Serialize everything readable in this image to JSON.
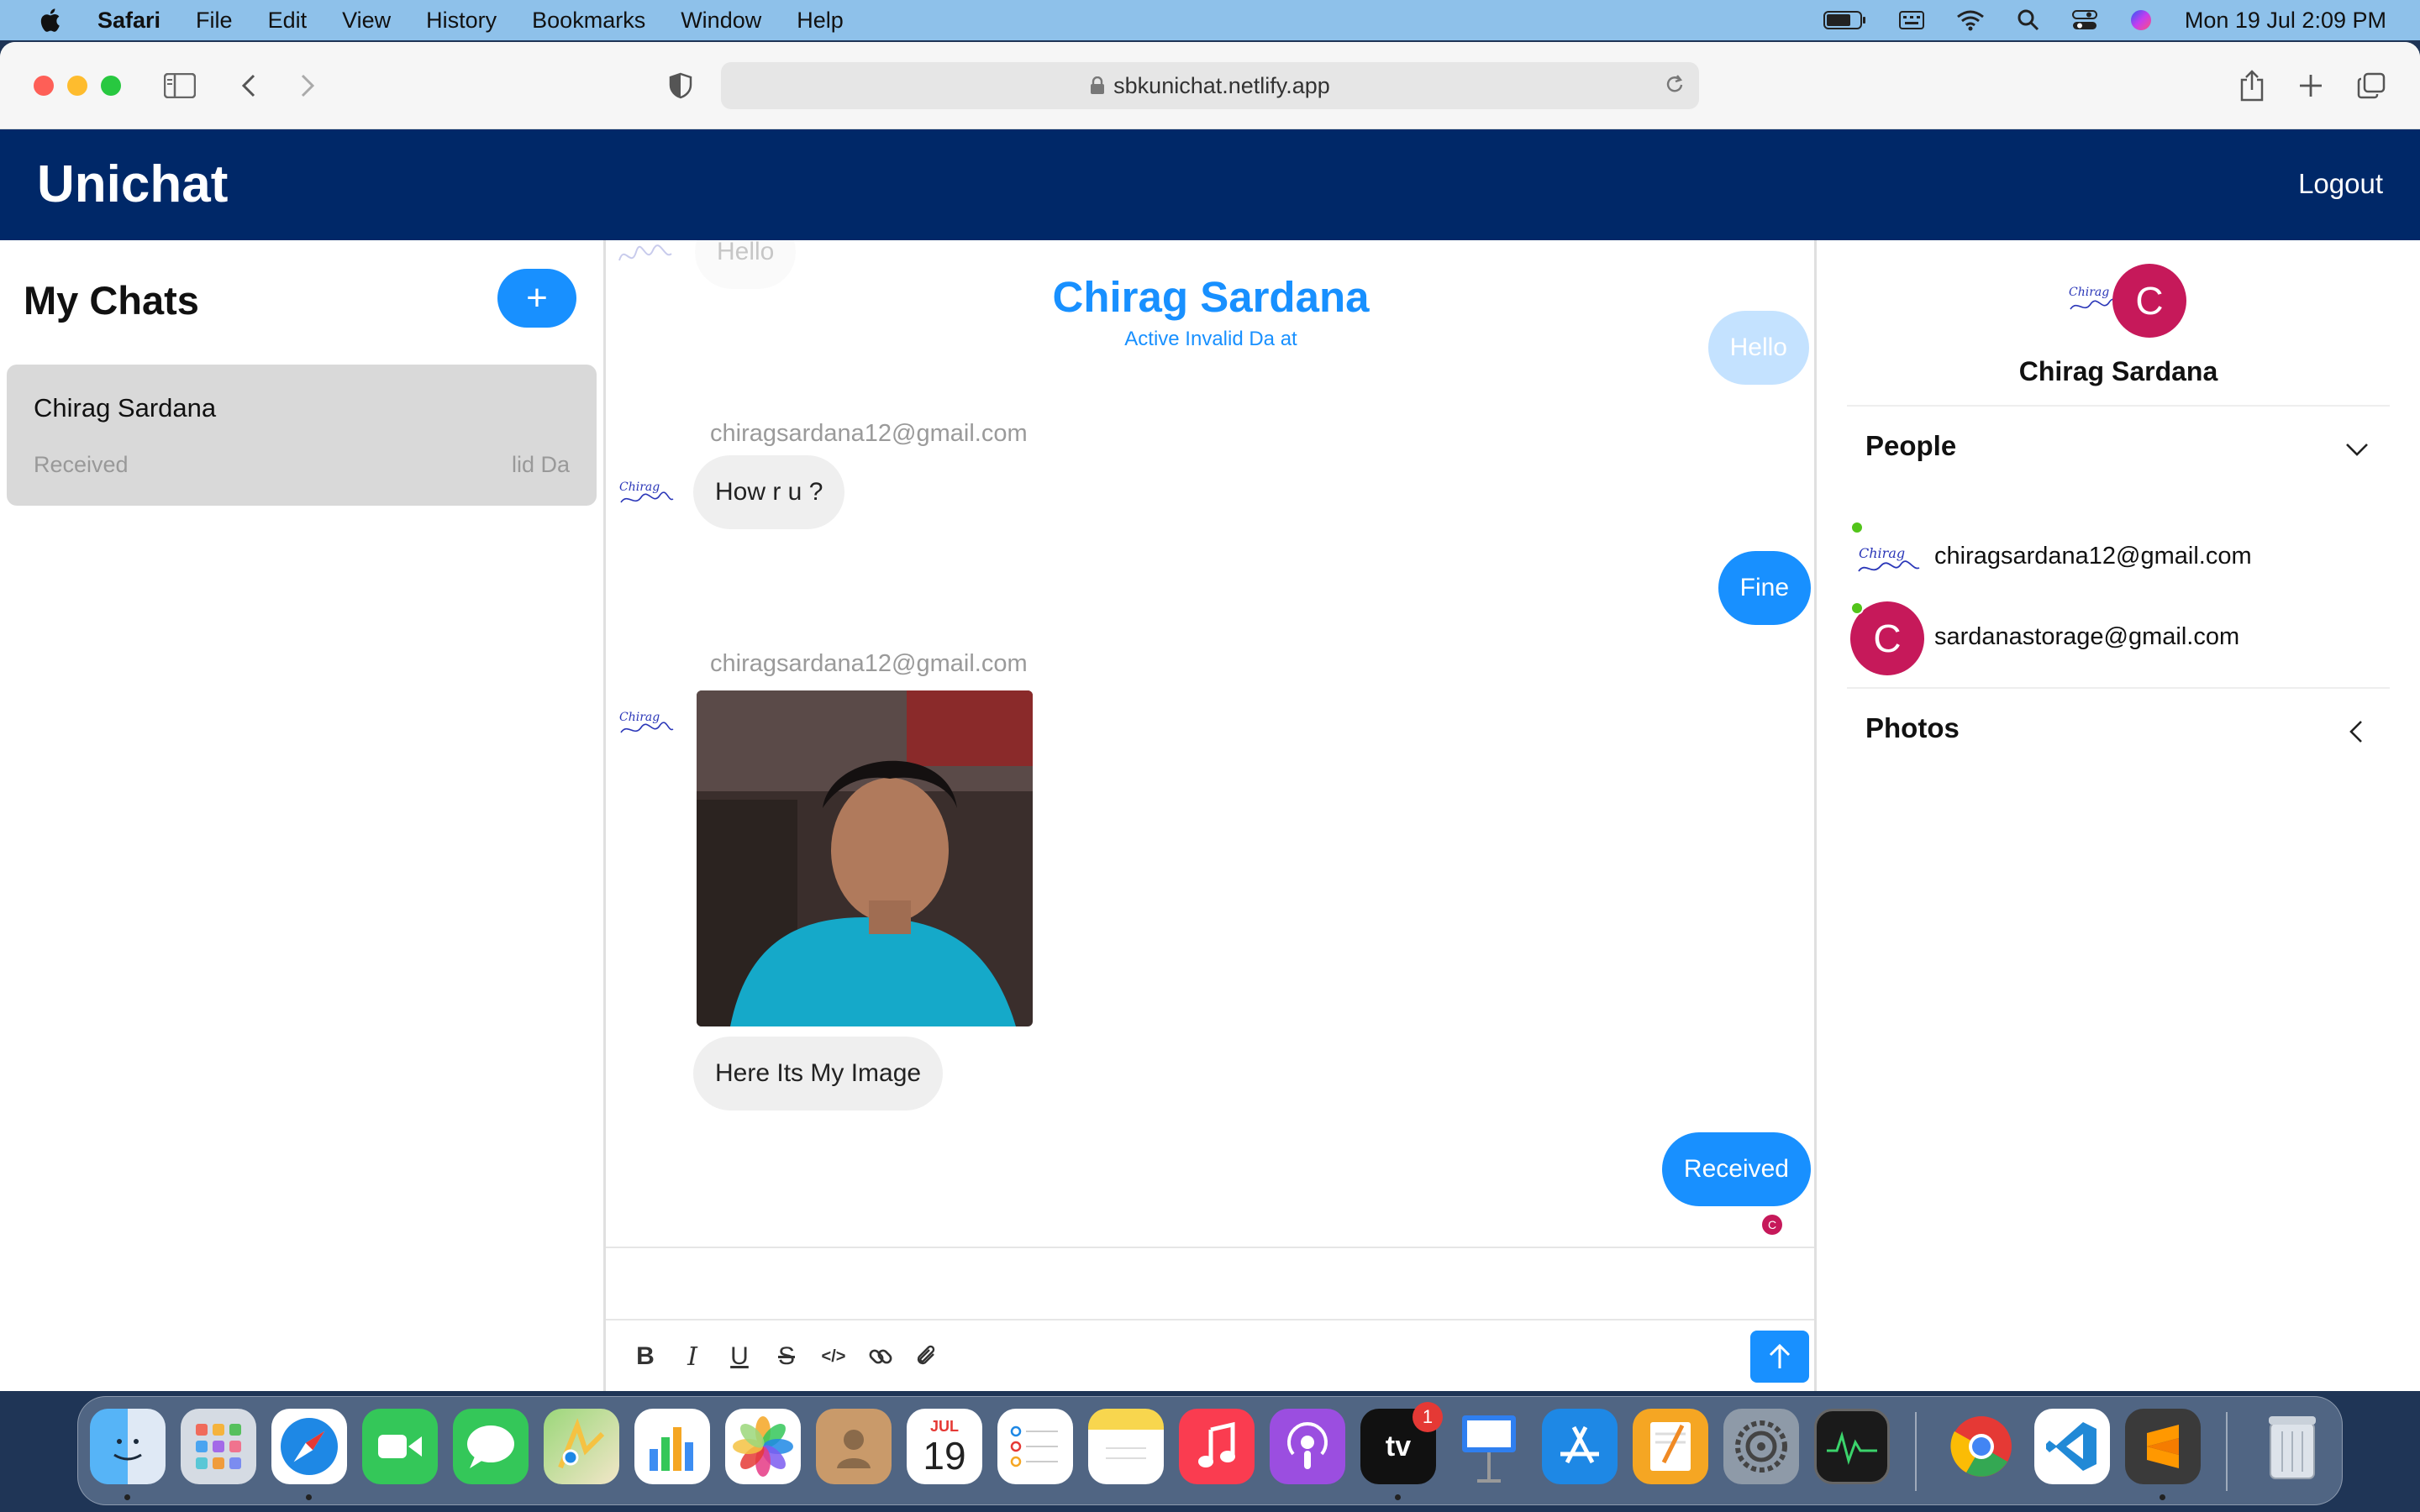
{
  "menubar": {
    "app_name": "Safari",
    "items": [
      "File",
      "Edit",
      "View",
      "History",
      "Bookmarks",
      "Window",
      "Help"
    ],
    "datetime": "Mon 19 Jul  2:09 PM"
  },
  "browser": {
    "url": "sbkunichat.netlify.app"
  },
  "app": {
    "brand": "Unichat",
    "logout_label": "Logout"
  },
  "chat_list": {
    "title": "My Chats",
    "new_button": "+",
    "chats": [
      {
        "name": "Chirag Sardana",
        "last_message": "Received",
        "time": "lid Da"
      }
    ]
  },
  "feed": {
    "title": "Chirag Sardana",
    "subtitle": "Active Invalid Da at",
    "faded_in": "Hello",
    "faded_out": "Hello",
    "messages": [
      {
        "sender": "chiragsardana12@gmail.com",
        "text": "How r u ?"
      },
      {
        "text": "Fine"
      },
      {
        "sender": "chiragsardana12@gmail.com",
        "text": "Here Its My Image"
      },
      {
        "text": "Received",
        "read_initial": "C"
      }
    ]
  },
  "composer": {
    "format_buttons": [
      "B",
      "I",
      "U",
      "S",
      "</>"
    ]
  },
  "settings": {
    "avatar_initial": "C",
    "name": "Chirag Sardana",
    "people_title": "People",
    "people": [
      {
        "email": "chiragsardana12@gmail.com"
      },
      {
        "email": "sardanastorage@gmail.com",
        "initial": "C"
      }
    ],
    "photos_title": "Photos"
  },
  "dock": {
    "calendar_month": "JUL",
    "calendar_day": "19",
    "tv_label": "tv",
    "tv_badge": "1"
  },
  "colors": {
    "header_bg": "#002868",
    "accent": "#1890ff",
    "avatar": "#c6195a",
    "online": "#52c41a"
  }
}
